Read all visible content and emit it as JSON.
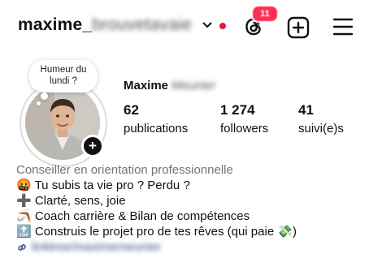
{
  "header": {
    "username_visible": "maxime_",
    "username_hidden": "brouvetavaie",
    "threads_badge": "11"
  },
  "note": {
    "text": "Humeur du lundi ?"
  },
  "profile": {
    "name_visible": "Maxime",
    "name_hidden": "Meunier"
  },
  "stats": {
    "posts_count": "62",
    "posts_label": "publications",
    "followers_count": "1 274",
    "followers_label": "followers",
    "following_count": "41",
    "following_label": "suivi(e)s"
  },
  "bio": {
    "category": "Conseiller en orientation professionnelle",
    "lines": [
      "🤬 Tu subis ta vie pro ? Perdu ?",
      "➕ Clarté, sens, joie",
      "🪃 Coach carrière & Bilan de compétences",
      "🔝 Construis le projet pro de tes rêves (qui paie 💸)"
    ],
    "link_hidden": "linktree/maximemeunier"
  },
  "colors": {
    "live_dot": "#e8143a",
    "badge": "#ff2d4f",
    "category_text": "#737373",
    "link": "#3a4d8f"
  },
  "icons": [
    "chevron-down-icon",
    "threads-icon",
    "create-plus-icon",
    "menu-icon",
    "add-story-icon",
    "link-icon"
  ]
}
